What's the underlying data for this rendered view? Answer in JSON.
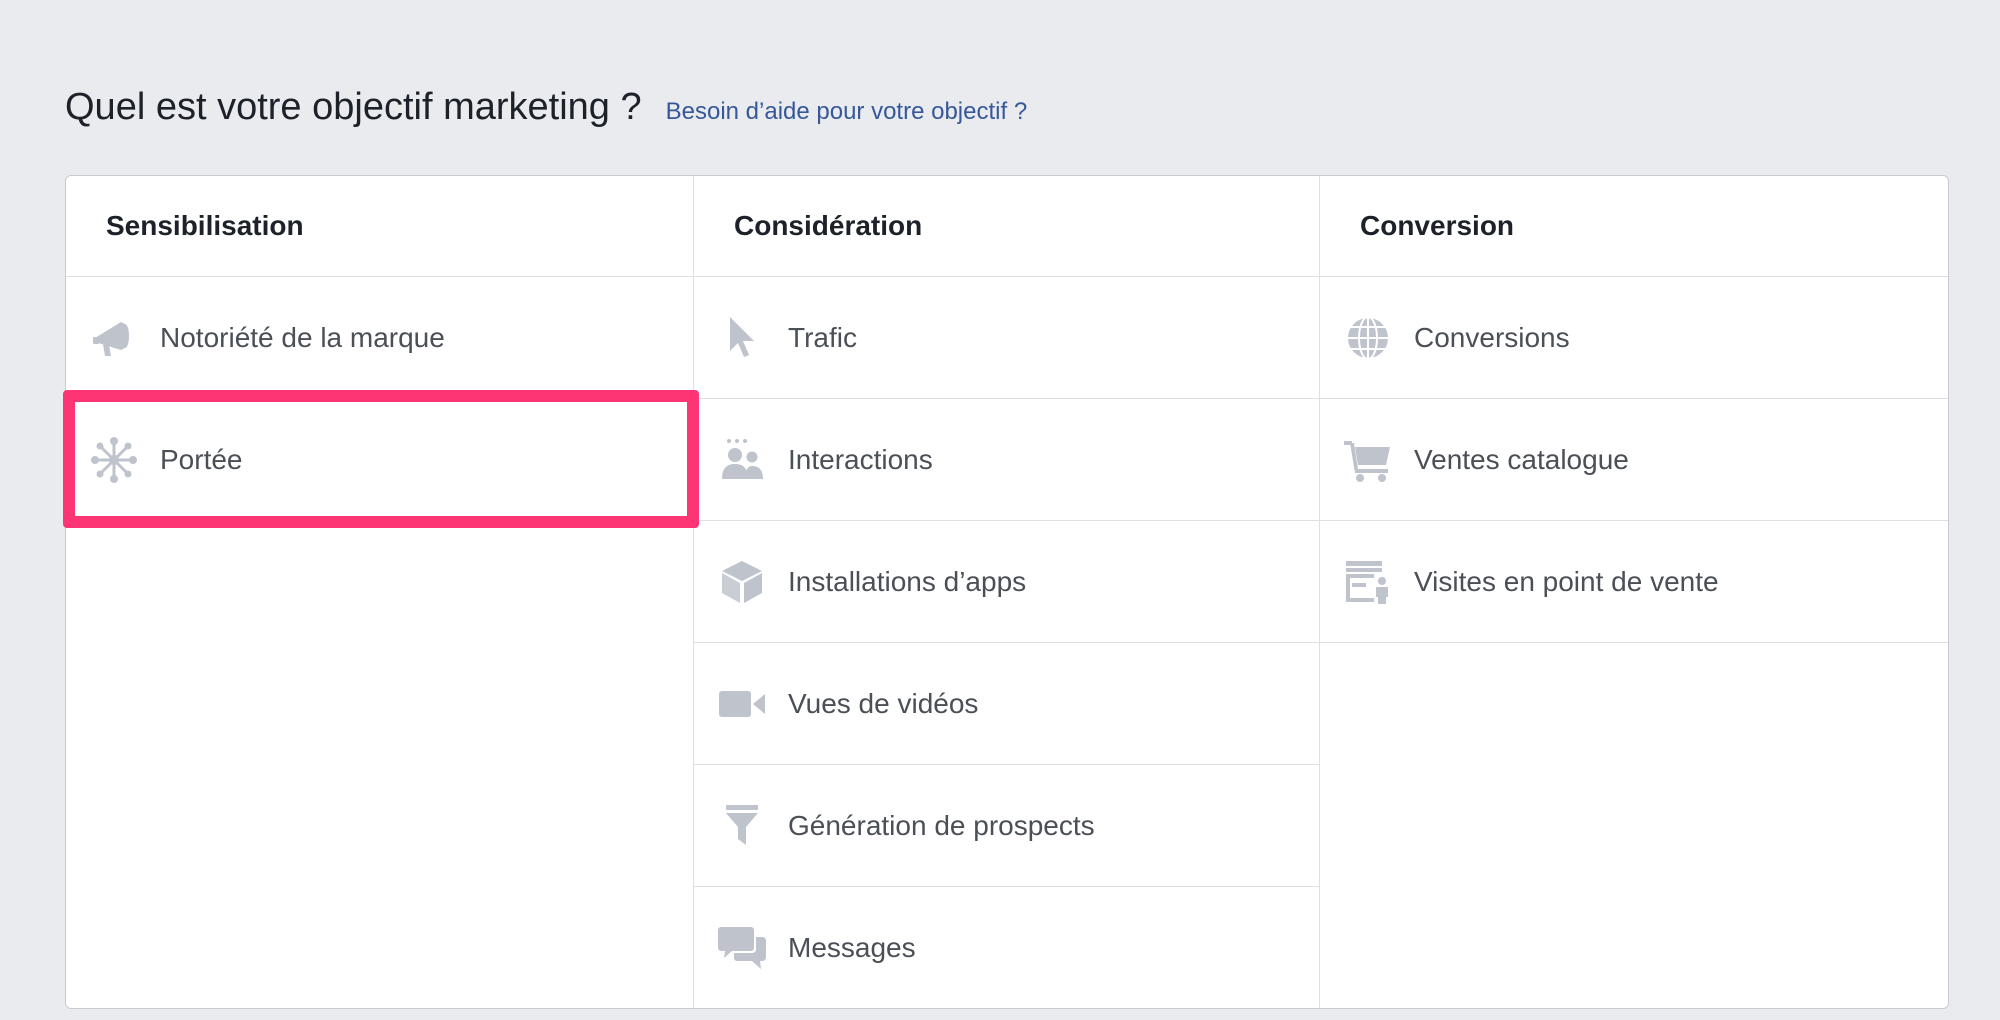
{
  "header": {
    "title": "Quel est votre objectif marketing ?",
    "help_link": "Besoin d’aide pour votre objectif ?"
  },
  "columns": [
    {
      "heading": "Sensibilisation",
      "items": [
        {
          "label": "Notoriété de la marque",
          "icon": "megaphone-icon"
        },
        {
          "label": "Portée",
          "icon": "reach-network-icon"
        }
      ]
    },
    {
      "heading": "Considération",
      "items": [
        {
          "label": "Trafic",
          "icon": "cursor-arrow-icon"
        },
        {
          "label": "Interactions",
          "icon": "people-icon"
        },
        {
          "label": "Installations d’apps",
          "icon": "cube-icon"
        },
        {
          "label": "Vues de vidéos",
          "icon": "video-camera-icon"
        },
        {
          "label": "Génération de prospects",
          "icon": "funnel-icon"
        },
        {
          "label": "Messages",
          "icon": "chat-bubbles-icon"
        }
      ]
    },
    {
      "heading": "Conversion",
      "items": [
        {
          "label": "Conversions",
          "icon": "globe-icon"
        },
        {
          "label": "Ventes catalogue",
          "icon": "shopping-cart-icon"
        },
        {
          "label": "Visites en point de vente",
          "icon": "store-icon"
        }
      ]
    }
  ],
  "colors": {
    "background": "#e9ebee",
    "link": "#365899",
    "highlight": "#fe3574",
    "icon": "#bec3cc",
    "text": "#4b4f56"
  }
}
